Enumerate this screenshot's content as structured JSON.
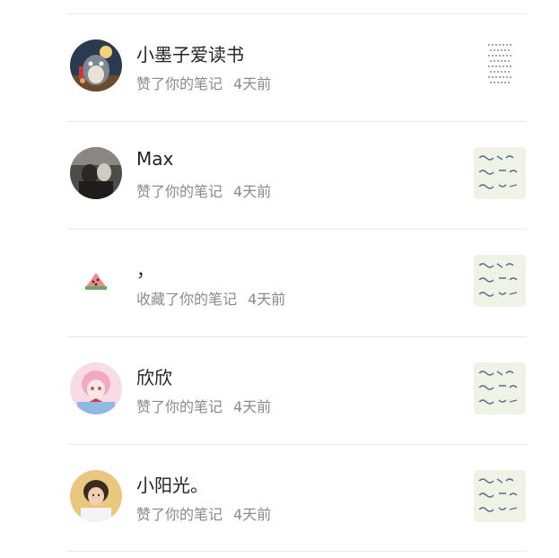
{
  "notifications": [
    {
      "user": "小墨子爱读书",
      "action": "赞了你的笔记",
      "time": "4天前",
      "avatar_icon": "totoro-avatar-icon"
    },
    {
      "user": "Max",
      "action": "赞了你的笔记",
      "time": "4天前",
      "avatar_icon": "photo-avatar-icon"
    },
    {
      "user": "，",
      "action": "收藏了你的笔记",
      "time": "4天前",
      "avatar_icon": "watermelon-avatar-icon"
    },
    {
      "user": "欣欣",
      "action": "赞了你的笔记",
      "time": "4天前",
      "avatar_icon": "anime-girl-avatar-icon"
    },
    {
      "user": "小阳光。",
      "action": "赞了你的笔记",
      "time": "4天前",
      "avatar_icon": "child-photo-avatar-icon"
    }
  ]
}
